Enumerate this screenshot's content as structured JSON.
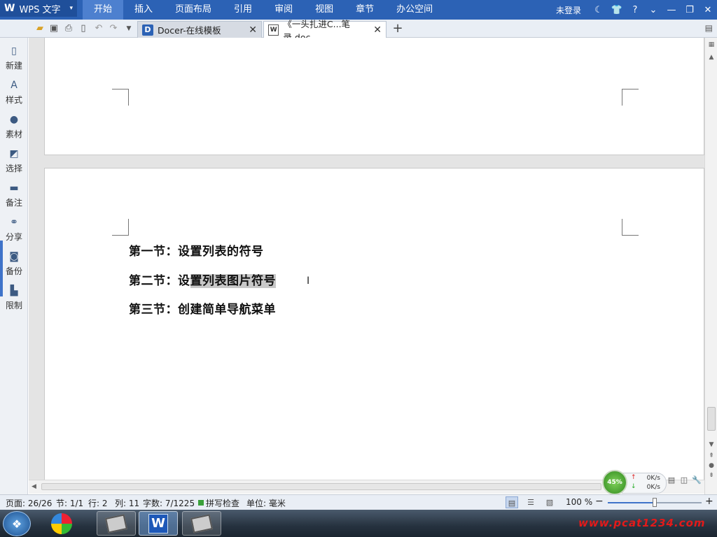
{
  "titlebar": {
    "app_logo": "W",
    "app_name": "WPS 文字",
    "app_dropdown": "▾",
    "menus": [
      "开始",
      "插入",
      "页面布局",
      "引用",
      "审阅",
      "视图",
      "章节",
      "办公空间"
    ],
    "active_menu": "开始",
    "login": "未登录",
    "help": "?"
  },
  "tabs": [
    {
      "icon": "D",
      "label": "Docer-在线模板",
      "close": "✕"
    },
    {
      "icon": "W",
      "label": "《一头扎进C...笔录.doc",
      "close": "✕"
    }
  ],
  "tab_add": "+",
  "sidebar": [
    {
      "icon": "new-doc-icon",
      "label": "新建"
    },
    {
      "icon": "style-icon",
      "label": "样式"
    },
    {
      "icon": "material-icon",
      "label": "素材"
    },
    {
      "icon": "select-icon",
      "label": "选择"
    },
    {
      "icon": "comment-icon",
      "label": "备注"
    },
    {
      "icon": "share-icon",
      "label": "分享"
    },
    {
      "icon": "backup-icon",
      "label": "备份"
    },
    {
      "icon": "restrict-icon",
      "label": "限制"
    }
  ],
  "document": {
    "lines": [
      {
        "prefix": "第一节：设置列表的符号",
        "selected": ""
      },
      {
        "prefix": "第二节：设",
        "selected": "置列表图片符号"
      },
      {
        "prefix": "第三节：创建简单导航菜单",
        "selected": ""
      }
    ]
  },
  "network": {
    "percent": "45%",
    "up": "0K/s",
    "down": "0K/s"
  },
  "status": {
    "page": "页面: 26/26",
    "section": "节: 1/1",
    "row": "行: 2",
    "col": "列: 11",
    "words": "字数: 7/1225",
    "spell": "拼写检查",
    "unit": "单位: 毫米",
    "zoom": "100 %",
    "zoom_out": "−",
    "zoom_in": "+",
    "zoom_fraction": 0.5
  },
  "taskbar": {
    "watermark": "www.pcat1234.com"
  },
  "colors": {
    "titlebar": "#2c62b5",
    "selection": "#c8c8c8",
    "watermark": "#e21a1a"
  }
}
